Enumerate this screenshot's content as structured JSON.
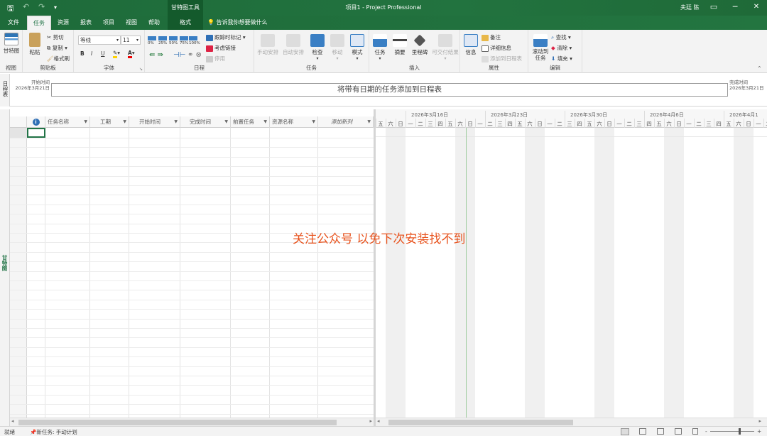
{
  "titlebar": {
    "context_tab": "甘特图工具",
    "title": "项目1 - Project Professional",
    "user": "夫廷 陈",
    "quick_access": [
      "save-icon",
      "undo-icon",
      "redo-icon",
      "customize-icon"
    ],
    "window_buttons": {
      "min": "─",
      "restore": "☐",
      "max": "□",
      "close": "✕"
    }
  },
  "tabs": [
    "文件",
    "任务",
    "资源",
    "报表",
    "项目",
    "视图",
    "帮助",
    "格式"
  ],
  "tell_me": "告诉我你想要做什么",
  "ribbon": {
    "view": {
      "gantt": "甘特图",
      "label": "视图"
    },
    "clipboard": {
      "paste": "粘贴",
      "cut": "剪切",
      "copy": "复制",
      "format_painter": "格式刷",
      "label": "剪贴板"
    },
    "font": {
      "name": "等线",
      "size": "11",
      "bold": "B",
      "italic": "I",
      "underline": "U",
      "label": "字体"
    },
    "schedule": {
      "pct": [
        "0%",
        "25%",
        "50%",
        "75%",
        "100%"
      ],
      "mark_on_track": "跟踪时标记",
      "respect_links": "考虑链接",
      "inactivate": "停用",
      "label": "日程"
    },
    "tasks": {
      "manual": "手动安排",
      "auto": "自动安排",
      "inspect": "检查",
      "move": "移动",
      "mode": "模式",
      "label": "任务"
    },
    "insert": {
      "task": "任务",
      "summary": "摘要",
      "milestone": "里程碑",
      "deliverable": "可交付结果",
      "label": "插入"
    },
    "properties": {
      "info": "信息",
      "notes": "备注",
      "details": "详细信息",
      "add_timeline": "添加到日程表",
      "label": "属性"
    },
    "editing": {
      "scroll_to_task": "滚动到\n任务",
      "find": "查找",
      "clear": "清除",
      "fill": "填充",
      "label": "编辑"
    }
  },
  "timeline": {
    "side_label": "日程表",
    "start_label": "开始时间",
    "start_date": "2026年3月21日",
    "finish_label": "完成时间",
    "finish_date": "2026年3月21日",
    "placeholder": "将带有日期的任务添加到日程表"
  },
  "side_view_label": "甘特图",
  "sheet": {
    "columns": [
      "任务名称",
      "工期",
      "开始时间",
      "完成时间",
      "前置任务",
      "资源名称",
      "添加新列"
    ]
  },
  "chart": {
    "weeks": [
      "2026年3月16日",
      "2026年3月23日",
      "2026年3月30日",
      "2026年4月6日",
      "2026年4月1"
    ],
    "days": [
      "五",
      "六",
      "日",
      "一",
      "二",
      "三",
      "四",
      "五",
      "六",
      "日",
      "一",
      "二",
      "三",
      "四",
      "五",
      "六",
      "日",
      "一",
      "二",
      "三",
      "四",
      "五",
      "六",
      "日",
      "一",
      "二",
      "三",
      "四",
      "五",
      "六",
      "日",
      "一",
      "二",
      "三",
      "四",
      "五",
      "六",
      "日",
      "一",
      "二"
    ]
  },
  "watermark": "关注公众号 以免下次安装找不到",
  "status": {
    "ready": "就绪",
    "new_tasks": "新任务: 手动计划"
  },
  "colors": {
    "brand": "#217346",
    "watermark": "#e8541f"
  }
}
